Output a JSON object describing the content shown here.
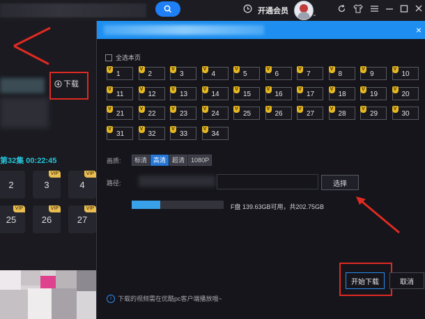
{
  "topbar": {
    "vip_label": "开通会员",
    "icons": [
      "search-icon",
      "clock-icon",
      "refresh-icon",
      "skin-icon",
      "menu-icon",
      "minimize-icon",
      "maximize-icon",
      "close-icon"
    ]
  },
  "left_panel": {
    "download_label": "下载",
    "episode_info": "第32集 00:22:45",
    "episodes": [
      {
        "num": "2",
        "vip": ""
      },
      {
        "num": "3",
        "vip": "VIP"
      },
      {
        "num": "4",
        "vip": "VIP"
      },
      {
        "num": "25",
        "vip": "VIP"
      },
      {
        "num": "26",
        "vip": "VIP"
      },
      {
        "num": "27",
        "vip": "VIP"
      }
    ]
  },
  "dialog": {
    "select_all": "全选本页",
    "vip_badge": "V",
    "episodes": [
      "1",
      "2",
      "3",
      "4",
      "5",
      "6",
      "7",
      "8",
      "9",
      "10",
      "11",
      "12",
      "13",
      "14",
      "15",
      "16",
      "17",
      "18",
      "19",
      "20",
      "21",
      "22",
      "23",
      "24",
      "25",
      "26",
      "27",
      "28",
      "29",
      "30",
      "31",
      "32",
      "33",
      "34"
    ],
    "quality_label": "画质:",
    "quality_options": [
      "标清",
      "高清",
      "超清",
      "1080P"
    ],
    "quality_selected": "高清",
    "path_label": "路径:",
    "select_button": "选择",
    "disk_info": "F盘 139.63GB可用，共202.75GB",
    "disk_usage_fraction": 0.31,
    "start_button": "开始下载",
    "cancel_button": "取消",
    "tip": "下载的视频需在优酷pc客户端播放哦~",
    "close_glyph": "×"
  },
  "colors": {
    "accent": "#1e8ff0",
    "highlight_box": "#e02a22",
    "vip_gold": "#e5b822",
    "episode_teal": "#26c4d8"
  }
}
